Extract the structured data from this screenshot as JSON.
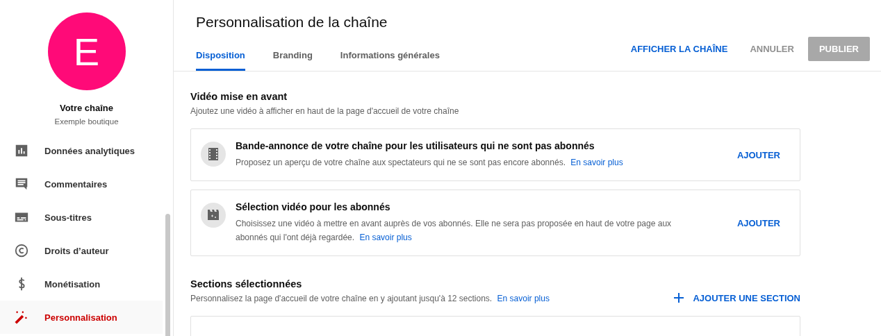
{
  "sidebar": {
    "avatar": {
      "letter": "E",
      "color": "#ff0a78"
    },
    "channel_title": "Votre chaîne",
    "channel_subtitle": "Exemple boutique",
    "items": [
      {
        "label": "Données analytiques",
        "kind": "analytics",
        "selected": false
      },
      {
        "label": "Commentaires",
        "kind": "comments",
        "selected": false
      },
      {
        "label": "Sous-titres",
        "kind": "subtitles",
        "selected": false
      },
      {
        "label": "Droits d’auteur",
        "kind": "copyright",
        "selected": false
      },
      {
        "label": "Monétisation",
        "kind": "money",
        "selected": false
      },
      {
        "label": "Personnalisation",
        "kind": "customize",
        "selected": true
      }
    ]
  },
  "header": {
    "title": "Personnalisation de la chaîne",
    "tabs": [
      {
        "label": "Disposition",
        "selected": true
      },
      {
        "label": "Branding",
        "selected": false
      },
      {
        "label": "Informations générales",
        "selected": false
      }
    ],
    "actions": [
      {
        "label": "AFFICHER LA CHAÎNE",
        "kind": "link",
        "disabled": false
      },
      {
        "label": "ANNULER",
        "kind": "text",
        "disabled": true
      },
      {
        "label": "PUBLIER",
        "kind": "filled",
        "disabled": true
      }
    ]
  },
  "featured": {
    "title": "Vidéo mise en avant",
    "description": "Ajoutez une vidéo à afficher en haut de la page d'accueil de votre chaîne",
    "cards": [
      {
        "kind": "film",
        "title": "Bande-annonce de votre chaîne pour les utilisateurs qui ne sont pas abonnés",
        "description": "Proposez un aperçu de votre chaîne aux spectateurs qui ne se sont pas encore abonnés.",
        "link": "En savoir plus",
        "action": "AJOUTER"
      },
      {
        "kind": "clapper",
        "title": "Sélection vidéo pour les abonnés",
        "description": "Choisissez une vidéo à mettre en avant auprès de vos abonnés. Elle ne sera pas proposée en haut de votre page aux abonnés qui l'ont déjà regardée.",
        "link": "En savoir plus",
        "action": "AJOUTER"
      }
    ]
  },
  "sections": {
    "title": "Sections sélectionnées",
    "description": "Personnalisez la page d'accueil de votre chaîne en y ajoutant jusqu'à 12 sections.",
    "link": "En savoir plus",
    "action": "AJOUTER UNE SECTION"
  }
}
